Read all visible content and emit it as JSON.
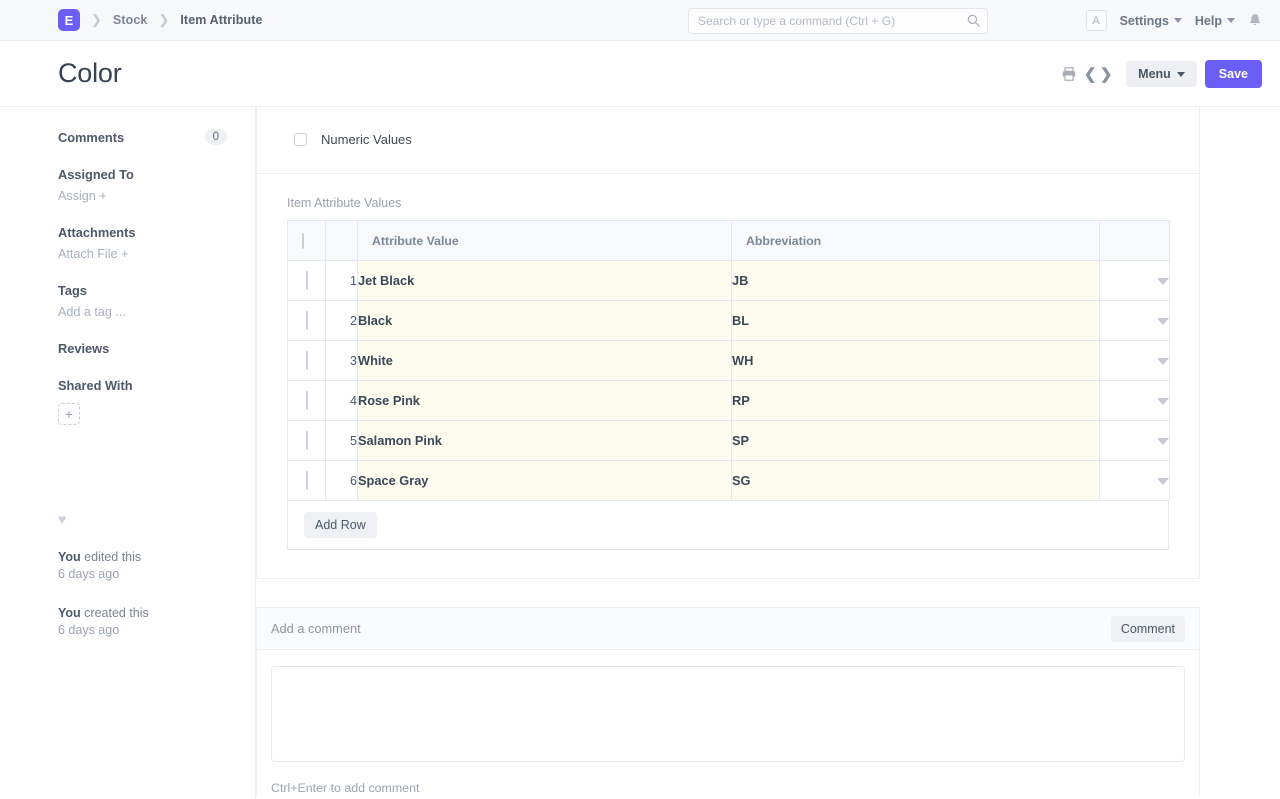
{
  "navbar": {
    "logo_letter": "E",
    "breadcrumbs": [
      {
        "label": "Stock"
      },
      {
        "label": "Item Attribute"
      }
    ],
    "search": {
      "placeholder": "Search or type a command (Ctrl + G)",
      "value": ""
    },
    "avatar_letter": "A",
    "settings_label": "Settings",
    "help_label": "Help"
  },
  "titlebar": {
    "title": "Color",
    "menu_label": "Menu",
    "save_label": "Save"
  },
  "sidebar": {
    "comments_label": "Comments",
    "comments_count": "0",
    "assigned_to_label": "Assigned To",
    "assign_action": "Assign +",
    "attachments_label": "Attachments",
    "attach_action": "Attach File +",
    "tags_label": "Tags",
    "add_tag_action": "Add a tag ...",
    "reviews_label": "Reviews",
    "shared_with_label": "Shared With",
    "share_add": "+",
    "activity": [
      {
        "actor": "You",
        "action": " edited this",
        "time": "6 days ago"
      },
      {
        "actor": "You",
        "action": " created this",
        "time": "6 days ago"
      }
    ]
  },
  "main": {
    "numeric_values_label": "Numeric Values",
    "numeric_values_checked": false,
    "grid_label": "Item Attribute Values",
    "columns": [
      "Attribute Value",
      "Abbreviation"
    ],
    "rows": [
      {
        "idx": "1",
        "value": "Jet Black",
        "abbr": "JB"
      },
      {
        "idx": "2",
        "value": "Black",
        "abbr": "BL"
      },
      {
        "idx": "3",
        "value": "White",
        "abbr": "WH"
      },
      {
        "idx": "4",
        "value": "Rose Pink",
        "abbr": "RP"
      },
      {
        "idx": "5",
        "value": "Salamon Pink",
        "abbr": "SP"
      },
      {
        "idx": "6",
        "value": "Space Gray",
        "abbr": "SG"
      }
    ],
    "add_row_label": "Add Row"
  },
  "comment_section": {
    "header_title": "Add a comment",
    "comment_button": "Comment",
    "textarea_value": "",
    "hint": "Ctrl+Enter to add comment"
  },
  "colors": {
    "accent": "#6b5ef5",
    "row_highlight": "#fdfcef",
    "navbar_bg": "#f7f8fa"
  }
}
